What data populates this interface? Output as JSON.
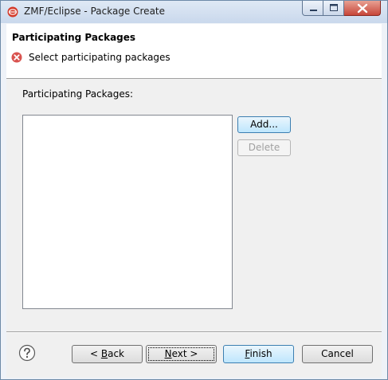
{
  "window": {
    "title": "ZMF/Eclipse - Package Create",
    "app_icon": "zmf-app-icon",
    "controls": [
      "minimize-icon",
      "maximize-icon",
      "close-icon"
    ]
  },
  "header": {
    "title": "Participating Packages",
    "message": "Select participating packages",
    "message_icon": "error-icon"
  },
  "main": {
    "list_label": "Participating Packages:",
    "list_items": [],
    "add_label": "Add...",
    "delete_label": "Delete"
  },
  "footer": {
    "help_icon": "help-icon",
    "back_prefix": "< ",
    "back_mnemonic": "B",
    "back_rest": "ack",
    "next_mnemonic": "N",
    "next_rest": "ext >",
    "finish_mnemonic": "F",
    "finish_rest": "inish",
    "cancel_label": "Cancel"
  },
  "colors": {
    "accent": "#3c7fb1",
    "error": "#c0392b",
    "dialog_bg": "#f0f0f0"
  }
}
